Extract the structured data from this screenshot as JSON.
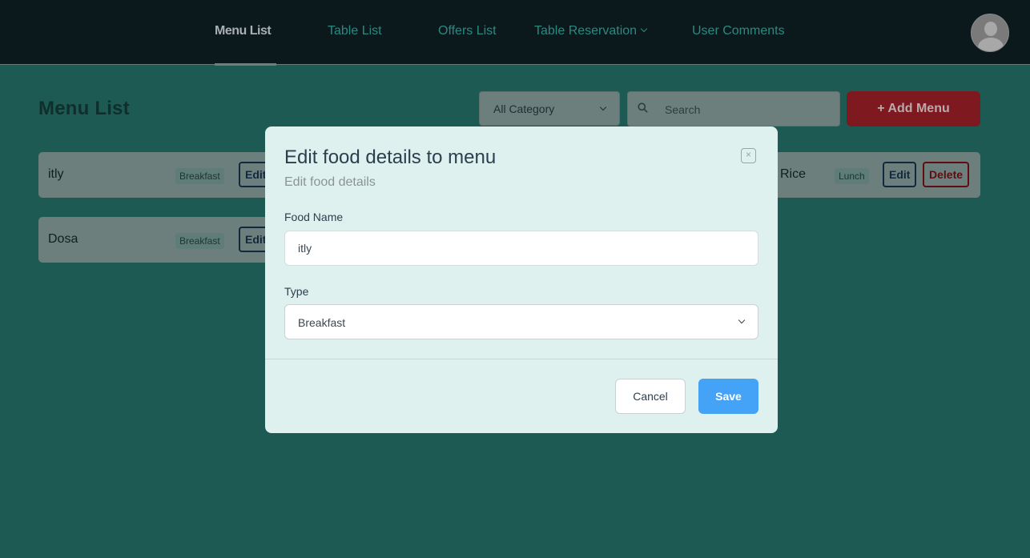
{
  "nav": {
    "items": [
      {
        "label": "Menu List",
        "active": true
      },
      {
        "label": "Table List",
        "active": false
      },
      {
        "label": "Offers List",
        "active": false
      },
      {
        "label": "Table Reservation",
        "active": false
      },
      {
        "label": "User Comments",
        "active": false
      }
    ],
    "avatar_icon": "user-avatar-icon"
  },
  "page": {
    "title": "Menu List",
    "category_filter": "All Category",
    "search_placeholder": "Search",
    "add_button": "+ Add Menu"
  },
  "cards": [
    {
      "name": "itly",
      "type": "Breakfast",
      "edit": "Edit"
    },
    {
      "name": "Dosa",
      "type": "Breakfast",
      "edit": "Edit"
    },
    {
      "name": "Rice",
      "type": "Lunch",
      "edit": "Edit",
      "delete": "Delete"
    }
  ],
  "modal": {
    "title": "Edit food details to menu",
    "subtitle": "Edit food details",
    "close_icon": "close-icon",
    "food_name_label": "Food Name",
    "food_name_value": "itly",
    "type_label": "Type",
    "type_value": "Breakfast",
    "cancel": "Cancel",
    "save": "Save"
  },
  "colors": {
    "background": "#1e5a54",
    "nav_bg": "#0b191d",
    "accent": "#2b8a80",
    "add_button": "#7e1a1f",
    "save_button": "#45a3f7",
    "modal_bg": "#dff1ef"
  }
}
